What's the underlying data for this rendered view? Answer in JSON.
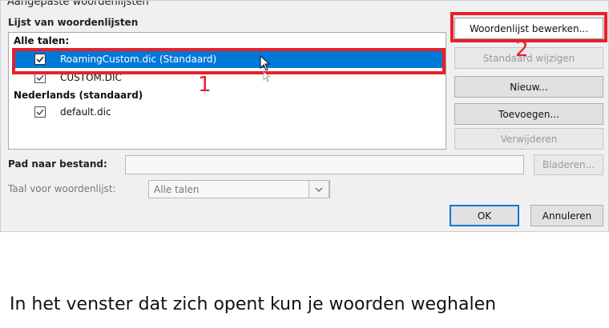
{
  "dialog": {
    "title": "Aangepaste woordenlijsten",
    "list_label": "Lijst van woordenlijsten",
    "groups": [
      {
        "header": "Alle talen:",
        "items": [
          {
            "label": "RoamingCustom.dic (Standaard)",
            "checked": true,
            "selected": true
          },
          {
            "label": "CUSTOM.DIC",
            "checked": true,
            "selected": false
          }
        ]
      },
      {
        "header": "Nederlands (standaard)",
        "items": [
          {
            "label": "default.dic",
            "checked": true,
            "selected": false
          }
        ]
      }
    ],
    "buttons": {
      "edit_wordlist": "Woordenlijst bewerken...",
      "change_default": "Standaard wijzigen",
      "new": "Nieuw...",
      "add": "Toevoegen...",
      "remove": "Verwijderen",
      "browse": "Bladeren...",
      "ok": "OK",
      "cancel": "Annuleren"
    },
    "path_label": "Pad naar bestand:",
    "path_value": "",
    "language_label": "Taal voor woordenlijst:",
    "language_value": "Alle talen"
  },
  "annotations": {
    "marker_1": "1",
    "marker_2": "2",
    "color": "#e8202a"
  },
  "caption": "In het venster dat zich opent kun je woorden weghalen",
  "colors": {
    "selection": "#0078d7",
    "dialog_bg": "#f0f0f0"
  }
}
